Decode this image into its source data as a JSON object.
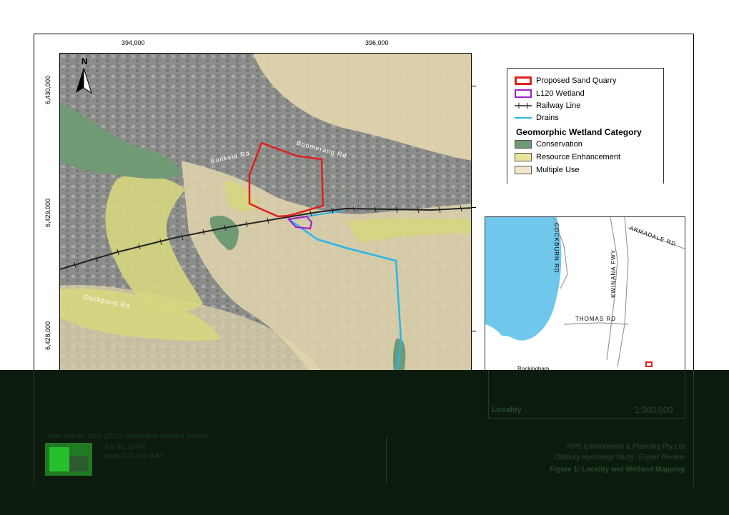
{
  "axes": {
    "x_ticks": [
      "394,000",
      "396,000"
    ],
    "y_ticks": [
      "6,430,000",
      "6,429,000",
      "6,428,000"
    ]
  },
  "map_labels": {
    "north": "N",
    "roads": [
      "Boomerang Rd",
      "Banksia Rd",
      "Duckpond Rd"
    ]
  },
  "legend": {
    "items": [
      {
        "label": "Proposed Sand Quarry",
        "color": "#e0201e",
        "style": "outline"
      },
      {
        "label": "L120 Wetland",
        "color": "#a020d0",
        "style": "outline"
      },
      {
        "label": "Railway Line",
        "color": "#222222",
        "style": "rail"
      },
      {
        "label": "Drains",
        "color": "#29b6e8",
        "style": "line"
      }
    ],
    "category_title": "Geomorphic Wetland Category",
    "categories": [
      {
        "label": "Conservation",
        "color": "#6f9a74"
      },
      {
        "label": "Resource Enhancement",
        "color": "#e8e59a"
      },
      {
        "label": "Multiple Use",
        "color": "#f3e4cc"
      }
    ]
  },
  "locality": {
    "roads": [
      "COCKBURN RD",
      "ARMADALE RD",
      "KWINANA FWY",
      "THOMAS RD"
    ],
    "place": "Rockingham",
    "title": "Locality",
    "scale": "1:300,000"
  },
  "footer": {
    "data_source": "Data Source: DEC (2013) Geomorphic Wetland Dataset",
    "job_no": "Job No. 25345",
    "scale": "Scale 1:20,000 @A4",
    "company": "RPS Environment & Planning Pty Ltd",
    "project": "Oldbury Hydrology Study- Expert Review",
    "figure": "Figure 1: Locality and Wetland Mapping"
  },
  "colors": {
    "urban": "#8d8f8d",
    "sand": "#e3d6ae",
    "conservation": "#6f9a74",
    "resource": "#d6d680",
    "water": "#6fc8ec",
    "dark_band": "#0d1b0e"
  }
}
